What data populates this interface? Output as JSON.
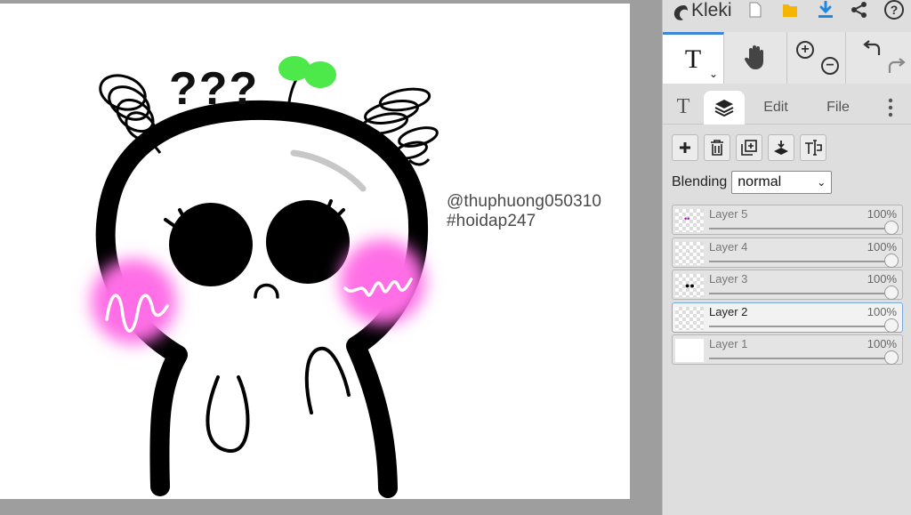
{
  "app": {
    "name": "Kleki"
  },
  "canvas": {
    "watermark_line1": "@thuphuong050310",
    "watermark_line2": "#hoidap247",
    "question_marks": "???"
  },
  "toolbar": {
    "text_tool_glyph": "T",
    "icons": [
      "new-image-icon",
      "save-icon",
      "download-icon",
      "share-icon",
      "help-icon"
    ],
    "help_glyph": "?"
  },
  "tabs": {
    "text_glyph": "T",
    "edit": "Edit",
    "file": "File"
  },
  "layer_tools": [
    "add-layer-icon",
    "delete-layer-icon",
    "duplicate-layer-icon",
    "merge-layer-icon",
    "rename-layer-icon"
  ],
  "blending": {
    "label": "Blending",
    "value": "normal"
  },
  "layers": [
    {
      "name": "Layer 5",
      "opacity": "100%",
      "active": false
    },
    {
      "name": "Layer 4",
      "opacity": "100%",
      "active": false
    },
    {
      "name": "Layer 3",
      "opacity": "100%",
      "active": false
    },
    {
      "name": "Layer 2",
      "opacity": "100%",
      "active": true
    },
    {
      "name": "Layer 1",
      "opacity": "100%",
      "active": false
    }
  ],
  "colors": {
    "accent": "#3a86d8",
    "download": "#1e88e5",
    "save": "#f5b400",
    "blush": "#ff6ee6",
    "sprout": "#4de84a"
  }
}
